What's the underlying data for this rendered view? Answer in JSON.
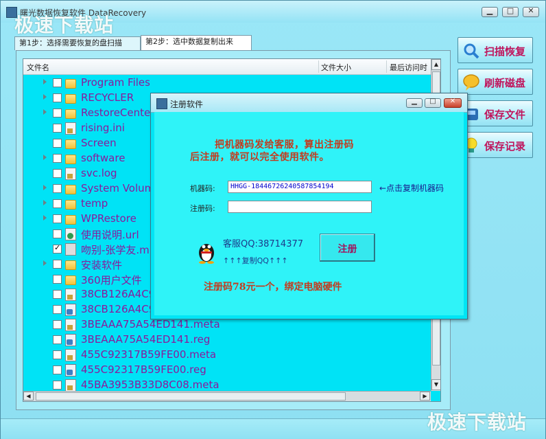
{
  "window": {
    "title": "曙光数据恢复软件 DataRecovery",
    "watermark": "极速下载站"
  },
  "tabs": [
    {
      "label": "第1步：选择需要恢复的盘扫描",
      "active": false
    },
    {
      "label": "第2步：选中数据复制出来",
      "active": true
    }
  ],
  "file_list": {
    "columns": [
      "文件名",
      "文件大小",
      "最后访问时"
    ],
    "rows": [
      {
        "name": "Program Files",
        "icon": "folder-icon",
        "expandable": true,
        "checked": false
      },
      {
        "name": "RECYCLER",
        "icon": "folder-icon",
        "expandable": true,
        "checked": false
      },
      {
        "name": "RestoreCenter",
        "icon": "folder-icon",
        "expandable": true,
        "checked": false
      },
      {
        "name": "rising.ini",
        "icon": "file-icon",
        "expandable": false,
        "checked": false
      },
      {
        "name": "Screen",
        "icon": "folder-icon",
        "expandable": false,
        "checked": false
      },
      {
        "name": "software",
        "icon": "folder-icon",
        "expandable": true,
        "checked": false
      },
      {
        "name": "svc.log",
        "icon": "file-icon",
        "expandable": false,
        "checked": false
      },
      {
        "name": "System Volume",
        "icon": "folder-icon",
        "expandable": true,
        "checked": false
      },
      {
        "name": "temp",
        "icon": "folder-icon",
        "expandable": true,
        "checked": false
      },
      {
        "name": "WPRestore",
        "icon": "folder-icon",
        "expandable": true,
        "checked": false
      },
      {
        "name": "使用说明.url",
        "icon": "url-icon",
        "expandable": false,
        "checked": false
      },
      {
        "name": "吻别-张学友.mp3",
        "icon": "media-file-icon",
        "expandable": false,
        "checked": true
      },
      {
        "name": "安装软件",
        "icon": "folder-icon",
        "expandable": true,
        "checked": false
      },
      {
        "name": "360用户文件",
        "icon": "folder-icon",
        "expandable": false,
        "checked": false
      },
      {
        "name": "38CB126A4C9",
        "icon": "file-icon",
        "expandable": false,
        "checked": false
      },
      {
        "name": "38CB126A4C9",
        "icon": "reg-file-icon",
        "expandable": false,
        "checked": false
      },
      {
        "name": "3BEAAA75A54ED141.meta",
        "icon": "file-icon",
        "expandable": false,
        "checked": false
      },
      {
        "name": "3BEAAA75A54ED141.reg",
        "icon": "reg-file-icon",
        "expandable": false,
        "checked": false
      },
      {
        "name": "455C92317B59FE00.meta",
        "icon": "file-icon",
        "expandable": false,
        "checked": false
      },
      {
        "name": "455C92317B59FE00.reg",
        "icon": "reg-file-icon",
        "expandable": false,
        "checked": false
      },
      {
        "name": "45BA3953B33D8C08.meta",
        "icon": "file-icon",
        "expandable": false,
        "checked": false
      }
    ]
  },
  "side_buttons": [
    {
      "label": "扫描恢复",
      "icon": "magnifier-icon",
      "color": "#2a7fd0"
    },
    {
      "label": "刷新磁盘",
      "icon": "speech-bubble-icon",
      "color": "#e8a81a"
    },
    {
      "label": "保存文件",
      "icon": "save-disk-icon",
      "color": "#2a6fb4"
    },
    {
      "label": "保存记录",
      "icon": "lightbulb-icon",
      "color": "#f2d21a"
    }
  ],
  "dialog": {
    "title": "注册软件",
    "message_line1": "把机器码发给客服，算出注册码",
    "message_line2": "后注册，就可以完全使用软件。",
    "machine_code_label": "机器码:",
    "machine_code_value": "HHGG-18446726240587854194",
    "copy_machine_code": "←点击复制机器码",
    "reg_code_label": "注册码:",
    "reg_code_value": "",
    "service_qq": "客服QQ:38714377",
    "copy_qq": "↑↑↑复制QQ↑↑↑",
    "register_button": "注册",
    "price_note": "注册码78元一个，绑定电脑硬件"
  },
  "colors": {
    "background": "#8ee0f2",
    "list_background": "#00e3f6",
    "filename_text": "#8a1a9c",
    "side_button_text": "#c0155c",
    "dialog_message": "#c23c1f"
  }
}
